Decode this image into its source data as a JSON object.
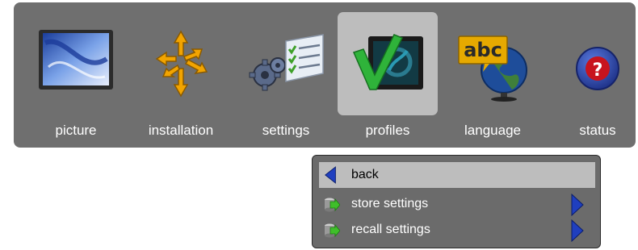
{
  "menu": {
    "items": [
      {
        "label": "picture",
        "icon": "picture-icon",
        "selected": false
      },
      {
        "label": "installation",
        "icon": "installation-icon",
        "selected": false
      },
      {
        "label": "settings",
        "icon": "settings-icon",
        "selected": false
      },
      {
        "label": "profiles",
        "icon": "profiles-icon",
        "selected": true
      },
      {
        "label": "language",
        "icon": "language-icon",
        "selected": false
      },
      {
        "label": "status",
        "icon": "status-icon",
        "selected": false
      }
    ],
    "language_icon_text": "abc",
    "status_icon_text": "?"
  },
  "submenu": {
    "items": [
      {
        "label": "back",
        "icon": "back-arrow-icon",
        "selected": true
      },
      {
        "label": "store settings",
        "icon": "store-settings-icon",
        "has_submenu": true
      },
      {
        "label": "recall settings",
        "icon": "recall-settings-icon",
        "has_submenu": true
      }
    ]
  },
  "colors": {
    "menu_background": "#6f6f6f",
    "selection": "#bdbdbd",
    "arrow_blue": "#1f3fbf",
    "accent_green": "#3fbf2a"
  }
}
